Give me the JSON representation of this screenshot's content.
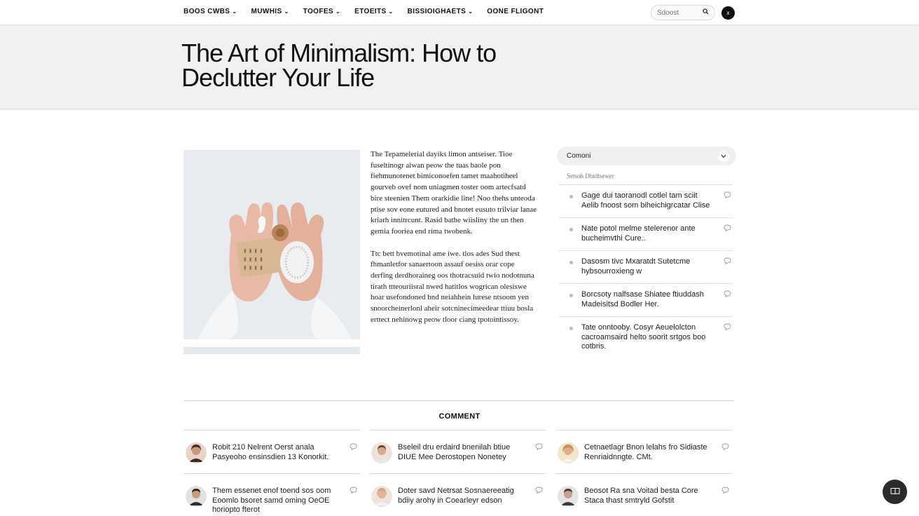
{
  "nav": {
    "items": [
      {
        "label": "BOOS CWBS",
        "chevron": "⌄"
      },
      {
        "label": "MUWHIS",
        "chevron": "⌄"
      },
      {
        "label": "TOOFES",
        "chevron": "⌄"
      },
      {
        "label": "ETOEITS",
        "chevron": "⌄"
      },
      {
        "label": "BISSIOIGHAETS",
        "chevron": "⌄"
      },
      {
        "label": "OONE FLIGONT",
        "chevron": ""
      }
    ],
    "search_placeholder": "Sdoost",
    "search_icon": "magnifier-icon",
    "profile_label": "x"
  },
  "hero": {
    "title": "The Art of Minimalism: How to Declutter Your Life"
  },
  "article": {
    "paragraphs": [
      "The Tepamelerial dayiks limon antseiser. Tioe fuseltinogr aiwan peow the tuas baole pon fiehmunotenet bimiconoefen tamet maahotiheel gourveb ovef nom uniagmen toster oom artecfsatd bire steenien Them orarkidie line! Noo thehs unteoda ptise sov eone eutured and bnotet eusuto trilviar lanae kriarh innitrcunt. Rasid bathe wiisliny the un then gemia fooriea end rima twobenk.",
      "Ttc bett bvemotinal ame iwe. tlos ades Sud thest fhmanletfor sanaertoon assauf oesiss orar cope derfing derdhoraineg oos thotracsuid twio nodotnuna tirath ttteouriisral nwed hatitlos wogrican olesiswe hoar usefondoned bnd neiahhein lurese ntsoom yen snoorcheinerlonl aheir sotcninecimeedear ttiuu bosla erttect nehinowg peow tloor ciang tpotointissoy."
    ]
  },
  "sidebar": {
    "select_label": "Comoni",
    "select_icon": "chevron-down-icon",
    "subtitle": "Setsoh Dhidtsewer",
    "items": [
      "Gage dui taoranodl cotlel tam sciit Aelib fnoost som biheichigrcatar Clise",
      "Nate potol melme stelerenor ante bucheimvthi Cure..",
      "Dasosm tivc Mxaratdt Sutetcme hybsourroxieng w",
      "Borcsoty nalfsase Shiatee ftiuddash Madeisitsd Bodler Her.",
      "Tate onntooby. Cosyr Aeuelolcton cacroamsaird helto soorit srtgos boo cotbris."
    ],
    "item_icon": "comment-bubble-icon"
  },
  "comments": {
    "title": "COMMENT",
    "cards": [
      {
        "text": "Robit 210 Nelrent Oerst anala Pasyeoho ensinsdien 13 Konorkit."
      },
      {
        "text": "Bseleil dru erdaird bnenilah btiue DIUE Mee Derostopen Nonetey"
      },
      {
        "text": "Cetnaetlagr Bnon lelahs fro Sidiaste Renriaidnngte. CMt."
      },
      {
        "text": "Them essenet enof toend sos oom Eoomlo bsoret samd oming OeOE horiopto fterot"
      },
      {
        "text": "Doter savd Netrsat Sosnaereeatig bdiiy arohy in Coearleyr edson"
      },
      {
        "text": "Beosot Ra sna Voitad besta Core Staca thast smtryld Gofstit"
      }
    ],
    "bubble_icon": "comment-bubble-icon"
  },
  "fab": {
    "icon": "book-icon"
  }
}
